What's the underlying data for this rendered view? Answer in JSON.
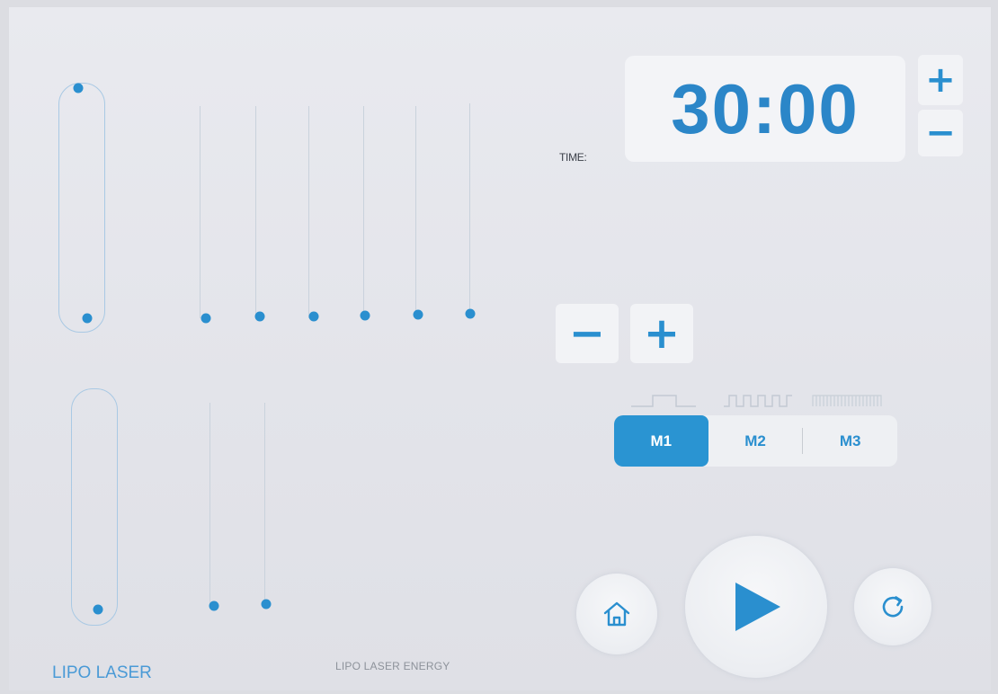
{
  "timer": {
    "label": "TIME:",
    "value": "30:00",
    "increase_label": "+",
    "decrease_label": "−"
  },
  "power": {
    "decrease_label": "−",
    "increase_label": "+"
  },
  "modes": {
    "items": [
      {
        "label": "M1",
        "active": true
      },
      {
        "label": "M2",
        "active": false
      },
      {
        "label": "M3",
        "active": false
      }
    ]
  },
  "controls": {
    "home_icon": "home-icon",
    "play_icon": "play-icon",
    "reset_icon": "refresh-icon"
  },
  "labels": {
    "lipo_laser": "LIPO LASER",
    "lipo_laser_energy": "LIPO LASER ENERGY"
  },
  "sliders": {
    "top_master_level": 1.0,
    "top_channel_levels": [
      0,
      0,
      0,
      0,
      0,
      0
    ],
    "bottom_master_level": 0,
    "bottom_channel_levels": [
      0,
      0
    ]
  },
  "colors": {
    "accent": "#2a8fcf",
    "active_mode": "#2a94d2",
    "background": "#e6e7ec"
  }
}
